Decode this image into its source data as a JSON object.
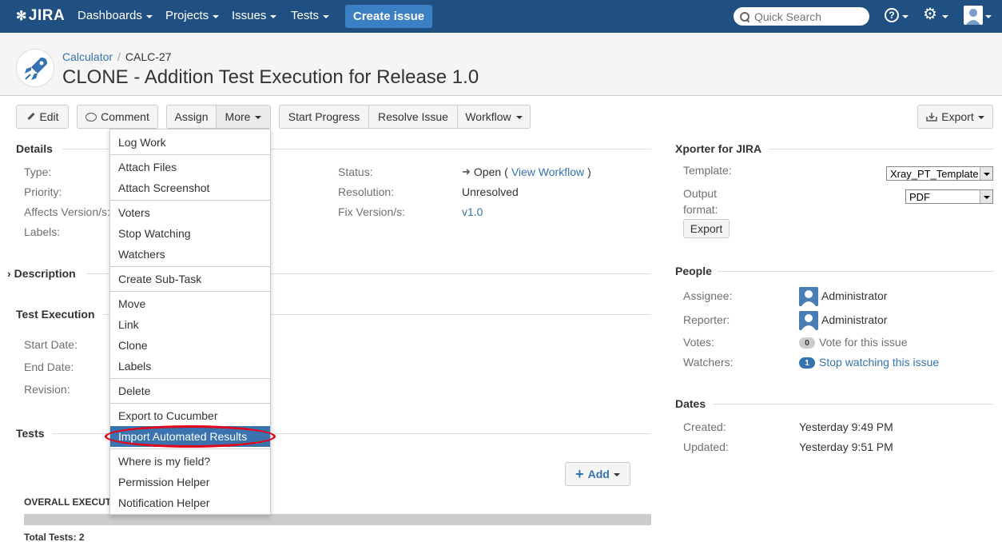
{
  "nav": {
    "logo": "JIRA",
    "items": [
      "Dashboards",
      "Projects",
      "Issues",
      "Tests"
    ],
    "create": "Create issue",
    "search_placeholder": "Quick Search"
  },
  "header": {
    "project": "Calculator",
    "sep": "/",
    "key": "CALC-27",
    "title": "CLONE - Addition Test Execution for Release 1.0"
  },
  "toolbar": {
    "edit": "Edit",
    "comment": "Comment",
    "assign": "Assign",
    "more": "More",
    "start_progress": "Start Progress",
    "resolve": "Resolve Issue",
    "workflow": "Workflow",
    "export": "Export"
  },
  "details": {
    "heading": "Details",
    "labels": [
      "Type:",
      "Priority:",
      "Affects Version/s:",
      "Labels:"
    ],
    "status_label": "Status:",
    "status_value": "Open",
    "view_workflow": "View Workflow",
    "resolution_label": "Resolution:",
    "resolution_value": "Unresolved",
    "fix_label": "Fix Version/s:",
    "fix_value": "v1.0"
  },
  "description": {
    "heading": "Description"
  },
  "test_execution": {
    "heading": "Test Execution",
    "labels": [
      "Start Date:",
      "End Date:",
      "Revision:"
    ]
  },
  "tests": {
    "heading": "Tests",
    "add": "Add",
    "overall": "OVERALL EXECUTIO",
    "total": "Total Tests: 2"
  },
  "menu": {
    "groups": [
      [
        "Log Work"
      ],
      [
        "Attach Files",
        "Attach Screenshot"
      ],
      [
        "Voters",
        "Stop Watching",
        "Watchers"
      ],
      [
        "Create Sub-Task"
      ],
      [
        "Move",
        "Link",
        "Clone",
        "Labels"
      ],
      [
        "Delete"
      ],
      [
        "Export to Cucumber",
        "Import Automated Results"
      ],
      [
        "Where is my field?",
        "Permission Helper",
        "Notification Helper"
      ]
    ],
    "highlighted": "Import Automated Results"
  },
  "xporter": {
    "heading": "Xporter for JIRA",
    "template_label": "Template:",
    "template_value": "Xray_PT_Template",
    "output_label_1": "Output",
    "output_label_2": "format:",
    "output_value": "PDF",
    "export_btn": "Export"
  },
  "people": {
    "heading": "People",
    "assignee_label": "Assignee:",
    "assignee": "Administrator",
    "reporter_label": "Reporter:",
    "reporter": "Administrator",
    "votes_label": "Votes:",
    "votes_count": "0",
    "votes_link": "Vote for this issue",
    "watchers_label": "Watchers:",
    "watchers_count": "1",
    "watchers_link": "Stop watching this issue"
  },
  "dates": {
    "heading": "Dates",
    "created_label": "Created:",
    "created": "Yesterday 9:49 PM",
    "updated_label": "Updated:",
    "updated": "Yesterday 9:51 PM"
  },
  "colors": {
    "nav_bg": "#205081",
    "create_bg": "#3b7fc4",
    "link": "#3572b0",
    "highlight": "#3b73af",
    "annotation": "#e3061b"
  }
}
